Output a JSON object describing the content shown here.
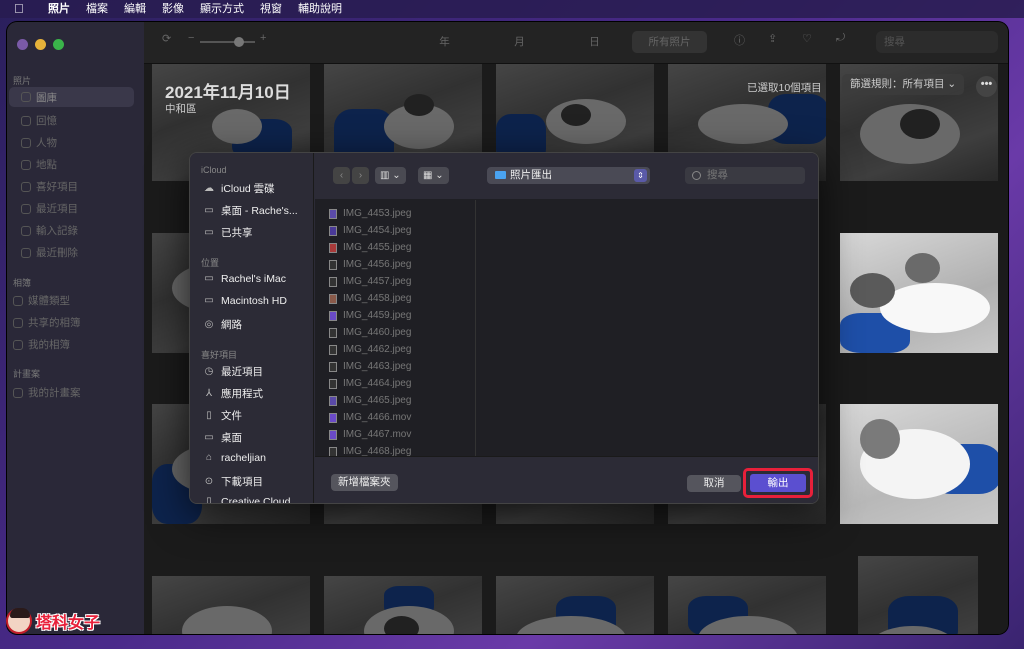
{
  "menubar": {
    "app": "照片",
    "items": [
      "檔案",
      "編輯",
      "影像",
      "顯示方式",
      "視窗",
      "輔助說明"
    ]
  },
  "sidebar": {
    "section_photos": "照片",
    "items": [
      "圖庫",
      "回憶",
      "人物",
      "地點",
      "喜好項目",
      "最近項目",
      "輸入記錄",
      "最近刪除"
    ],
    "section_albums": "相簿",
    "albums": [
      "媒體類型",
      "共享的相簿",
      "我的相簿"
    ],
    "section_projects": "計畫案",
    "projects": [
      "我的計畫案"
    ]
  },
  "toolbar": {
    "zoom_minus": "−",
    "zoom_plus": "+",
    "tabs": [
      "年",
      "月",
      "日",
      "所有照片"
    ],
    "search_placeholder": "搜尋"
  },
  "main": {
    "date_title": "2021年11月10日",
    "location": "中和區",
    "selected_count": "已選取10個項目",
    "filter_label": "篩選規則：",
    "filter_value": "所有項目",
    "more": "•••"
  },
  "dialog": {
    "sections": {
      "icloud": "iCloud",
      "locations": "位置",
      "favorites": "喜好項目"
    },
    "icloud_items": [
      "iCloud 雲碟",
      "桌面 - Rache's...",
      "已共享"
    ],
    "location_items": [
      "Rachel's iMac",
      "Macintosh HD",
      "網路"
    ],
    "favorite_items": [
      "最近項目",
      "應用程式",
      "文件",
      "桌面",
      "racheljian",
      "下載項目",
      "Creative Cloud..."
    ],
    "location_folder": "照片匯出",
    "search_placeholder": "搜尋",
    "files": [
      "IMG_4453.jpeg",
      "IMG_4454.jpeg",
      "IMG_4455.jpeg",
      "IMG_4456.jpeg",
      "IMG_4457.jpeg",
      "IMG_4458.jpeg",
      "IMG_4459.jpeg",
      "IMG_4460.jpeg",
      "IMG_4462.jpeg",
      "IMG_4463.jpeg",
      "IMG_4464.jpeg",
      "IMG_4465.jpeg",
      "IMG_4466.mov",
      "IMG_4467.mov",
      "IMG_4468.jpeg"
    ],
    "new_folder": "新增檔案夾",
    "cancel": "取消",
    "export": "輸出"
  },
  "watermark": "塔科女子",
  "colors": {
    "accent": "#5b4fd0",
    "highlight": "#e8203a",
    "folder": "#4aa3f0"
  }
}
